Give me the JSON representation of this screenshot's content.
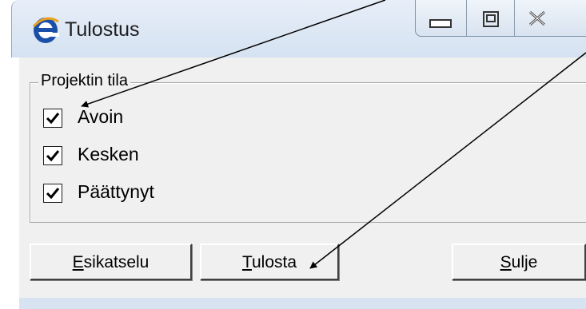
{
  "window": {
    "title": "Tulostus",
    "icon": "ie-e-icon",
    "controls": [
      "minimize-icon",
      "maximize-icon",
      "close-icon"
    ]
  },
  "group": {
    "legend": "Projektin tila",
    "checkboxes": [
      {
        "label": "Avoin",
        "checked": true
      },
      {
        "label": "Kesken",
        "checked": true
      },
      {
        "label": "Päättynyt",
        "checked": true
      }
    ]
  },
  "buttons": {
    "preview": {
      "accel": "E",
      "rest": "sikatselu"
    },
    "print": {
      "accel": "T",
      "rest": "ulosta"
    },
    "close": {
      "accel": "S",
      "rest": "ulje"
    }
  },
  "colors": {
    "title_gradient_top": "#e7eef8",
    "client_bg": "#f0f0f0",
    "icon_blue": "#1a4fa8"
  }
}
